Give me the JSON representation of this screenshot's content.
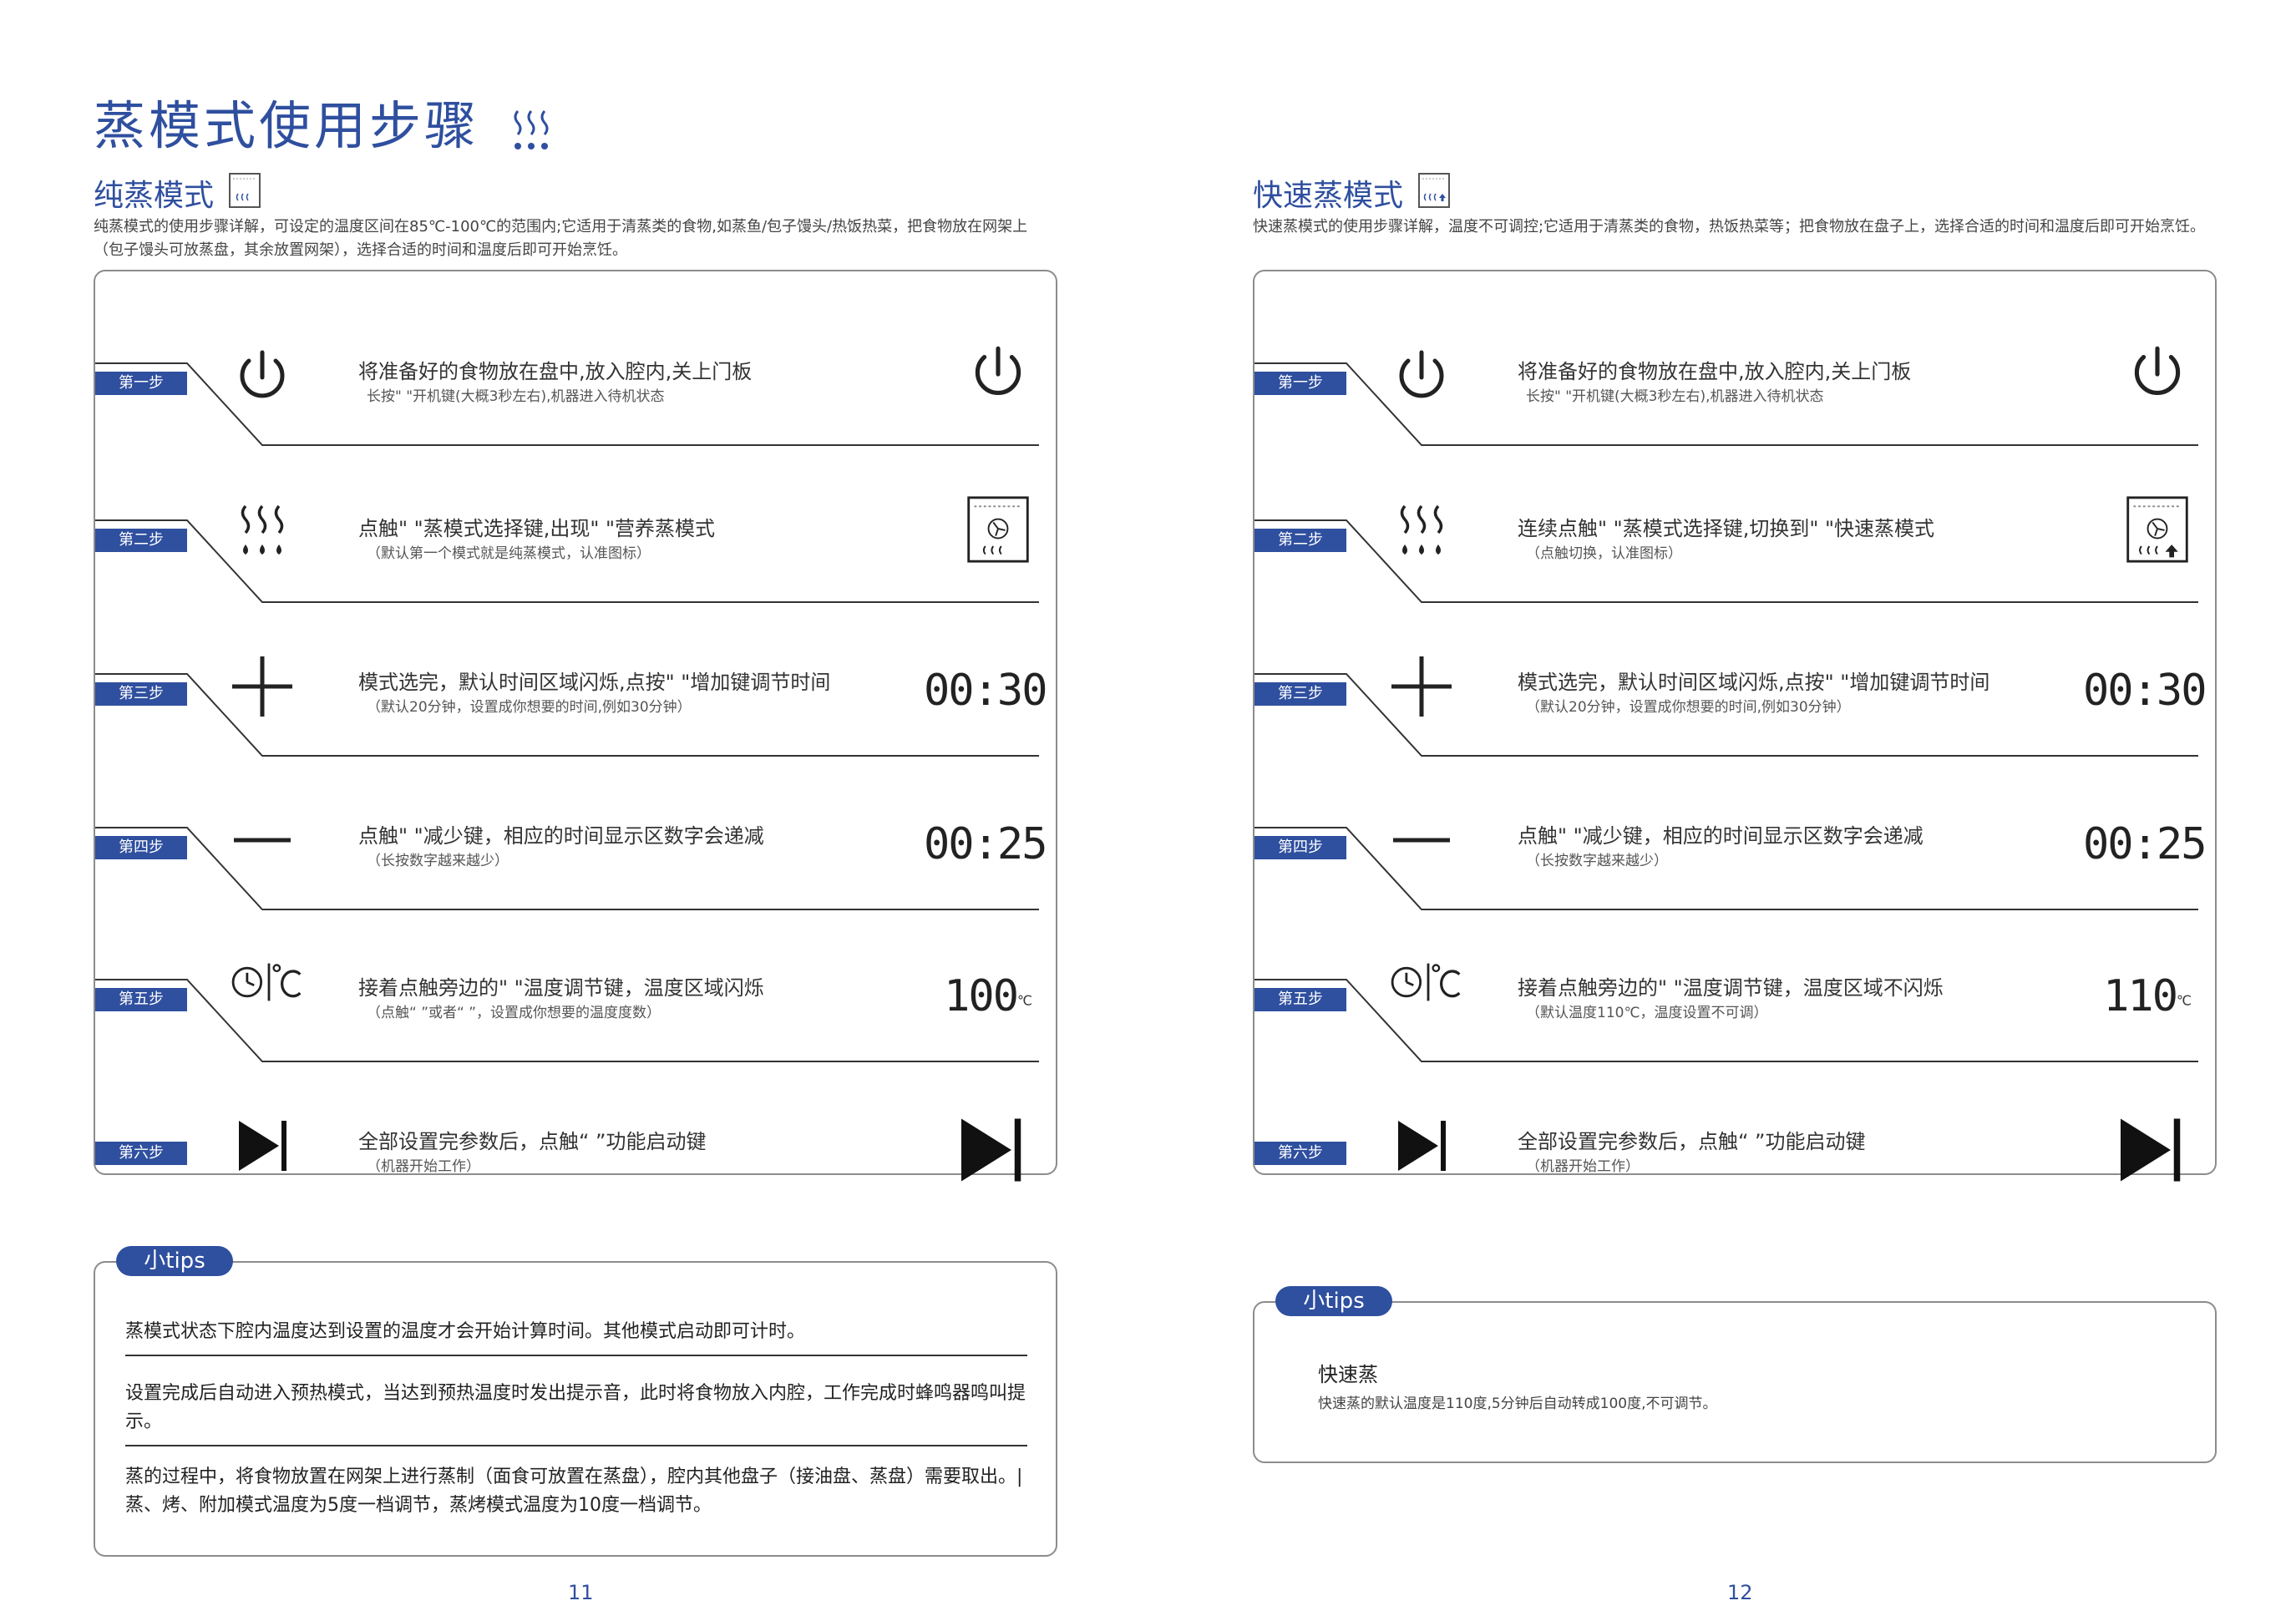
{
  "page_left": {
    "main_title": "蒸模式使用步骤",
    "section_title": "纯蒸模式",
    "intro": "纯蒸模式的使用步骤详解，可设定的温度区间在85℃-100℃的范围内;它适用于清蒸类的食物,如蒸鱼/包子馒头/热饭热菜，把食物放在网架上（包子馒头可放蒸盘，其余放置网架），选择合适的时间和温度后即可开始烹饪。",
    "steps": [
      {
        "badge": "第一步",
        "main": "将准备好的食物放在盘中,放入腔内,关上门板",
        "sub": "长按\"  \"开机键(大概3秒左右),机器进入待机状态",
        "icon": "power-icon",
        "right": "power-icon"
      },
      {
        "badge": "第二步",
        "main": "点触\"   \"蒸模式选择键,出现\"   \"营养蒸模式",
        "sub": "（默认第一个模式就是纯蒸模式，认准图标）",
        "icon": "steam-icon",
        "right": "pure-steam-mode-icon"
      },
      {
        "badge": "第三步",
        "main": "模式选完，默认时间区域闪烁,点按\"  \"增加键调节时间",
        "sub": "（默认20分钟，设置成你想要的时间,例如30分钟）",
        "icon": "plus-icon",
        "right_text": "00:30"
      },
      {
        "badge": "第四步",
        "main": "点触\"  \"减少键，相应的时间显示区数字会递减",
        "sub": "（长按数字越来越少）",
        "icon": "minus-icon",
        "right_text": "00:25"
      },
      {
        "badge": "第五步",
        "main": "接着点触旁边的\"     \"温度调节键，温度区域闪烁",
        "sub": "（点触“  ”或者“  ”，设置成你想要的温度度数）",
        "icon": "clock-temp-icon",
        "right_text": "100",
        "right_unit": "℃"
      },
      {
        "badge": "第六步",
        "main": "全部设置完参数后，点触“  ”功能启动键",
        "sub": "（机器开始工作）",
        "icon": "start-icon",
        "right": "start-icon"
      }
    ],
    "tips_label": "小tips",
    "tips": [
      "蒸模式状态下腔内温度达到设置的温度才会开始计算时间。其他模式启动即可计时。",
      "设置完成后自动进入预热模式，当达到预热温度时发出提示音，此时将食物放入内腔，工作完成时蜂鸣器鸣叫提示。",
      "蒸的过程中，将食物放置在网架上进行蒸制（面食可放置在蒸盘），腔内其他盘子（接油盘、蒸盘）需要取出。| 蒸、烤、附加模式温度为5度一档调节，蒸烤模式温度为10度一档调节。"
    ],
    "page_number": "11"
  },
  "page_right": {
    "section_title": "快速蒸模式",
    "intro": "快速蒸模式的使用步骤详解，温度不可调控;它适用于清蒸类的食物，热饭热菜等；把食物放在盘子上，选择合适的时间和温度后即可开始烹饪。",
    "steps": [
      {
        "badge": "第一步",
        "main": "将准备好的食物放在盘中,放入腔内,关上门板",
        "sub": "长按\"  \"开机键(大概3秒左右),机器进入待机状态",
        "icon": "power-icon",
        "right": "power-icon"
      },
      {
        "badge": "第二步",
        "main": "连续点触\"   \"蒸模式选择键,切换到\"   \"快速蒸模式",
        "sub": "（点触切换，认准图标）",
        "icon": "steam-icon",
        "right": "quick-steam-mode-icon"
      },
      {
        "badge": "第三步",
        "main": "模式选完，默认时间区域闪烁,点按\"  \"增加键调节时间",
        "sub": "（默认20分钟，设置成你想要的时间,例如30分钟）",
        "icon": "plus-icon",
        "right_text": "00:30"
      },
      {
        "badge": "第四步",
        "main": "点触\"  \"减少键，相应的时间显示区数字会递减",
        "sub": "（长按数字越来越少）",
        "icon": "minus-icon",
        "right_text": "00:25"
      },
      {
        "badge": "第五步",
        "main": "接着点触旁边的\"     \"温度调节键，温度区域不闪烁",
        "sub": "（默认温度110℃，温度设置不可调）",
        "icon": "clock-temp-icon",
        "right_text": "110",
        "right_unit": "℃"
      },
      {
        "badge": "第六步",
        "main": "全部设置完参数后，点触“  ”功能启动键",
        "sub": "（机器开始工作）",
        "icon": "start-icon",
        "right": "start-icon"
      }
    ],
    "tips_label": "小tips",
    "tips_title": "快速蒸",
    "tips_text": "快速蒸的默认温度是110度,5分钟后自动转成100度,不可调节。",
    "page_number": "12"
  },
  "colors": {
    "accent": "#2f4f9f",
    "border": "#8c8c8c",
    "text": "#333333"
  }
}
